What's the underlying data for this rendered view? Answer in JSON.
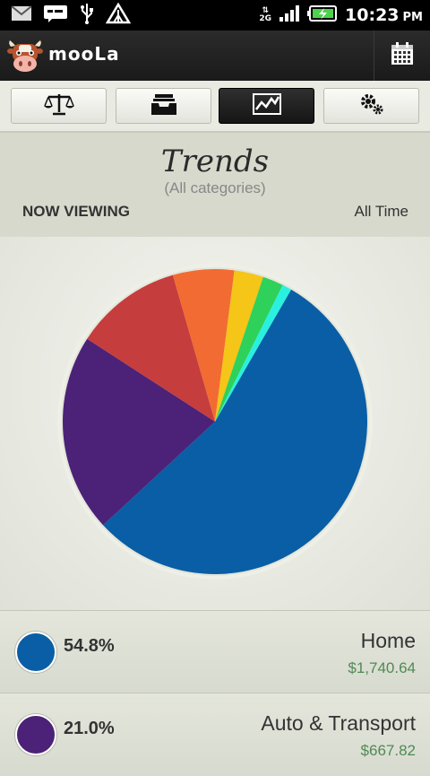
{
  "status_bar": {
    "time": "10:23",
    "ampm": "PM",
    "network": "2G",
    "icons": [
      "gmail-icon",
      "message-icon",
      "usb-icon",
      "warning-icon",
      "data-arrows-icon",
      "signal-icon",
      "battery-charging-icon"
    ]
  },
  "app": {
    "title": "mooLa",
    "logo_icon": "cow-icon",
    "calendar_icon": "calendar-icon"
  },
  "tabs": [
    {
      "name": "balance",
      "icon": "scale-icon",
      "active": false
    },
    {
      "name": "inbox",
      "icon": "inbox-tray-icon",
      "active": false
    },
    {
      "name": "trends",
      "icon": "trend-chart-icon",
      "active": true
    },
    {
      "name": "settings",
      "icon": "gears-icon",
      "active": false
    }
  ],
  "header": {
    "title": "Trends",
    "subtitle": "(All categories)",
    "now_viewing_label": "NOW VIEWING",
    "period": "All Time"
  },
  "chart_data": {
    "type": "pie",
    "slices": [
      {
        "label": "Home",
        "percent": 54.8,
        "color": "#0a5ea6"
      },
      {
        "label": "Auto & Transport",
        "percent": 21.0,
        "color": "#4b2277"
      },
      {
        "label": "",
        "percent": 11.4,
        "color": "#c63d3d"
      },
      {
        "label": "",
        "percent": 6.5,
        "color": "#f26b32"
      },
      {
        "label": "",
        "percent": 3.1,
        "color": "#f5c518"
      },
      {
        "label": "",
        "percent": 2.2,
        "color": "#2ed15a"
      },
      {
        "label": "",
        "percent": 1.0,
        "color": "#2af0e0"
      }
    ],
    "start_slice_boundary_deg": 30,
    "direction": "clockwise"
  },
  "list": [
    {
      "percent": "54.8%",
      "category": "Home",
      "amount": "$1,740.64",
      "color": "#0a5ea6"
    },
    {
      "percent": "21.0%",
      "category": "Auto & Transport",
      "amount": "$667.82",
      "color": "#4b2277"
    }
  ]
}
